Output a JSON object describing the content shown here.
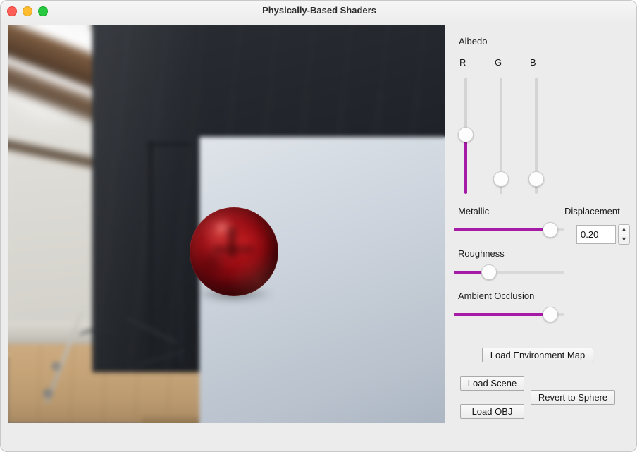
{
  "window": {
    "title": "Physically-Based Shaders",
    "traffic_lights": [
      {
        "name": "close",
        "color": "#ff5f57"
      },
      {
        "name": "minimize",
        "color": "#febc2e"
      },
      {
        "name": "maximize",
        "color": "#28c840"
      }
    ],
    "background": "#ececec"
  },
  "viewport": {
    "name": "3d-render-viewport",
    "description": "Blurred studio environment with metallic red PBR sphere"
  },
  "panel": {
    "albedo": {
      "label": "Albedo",
      "accent": "#a61ba6",
      "channels": [
        {
          "label": "R",
          "value": 0.51,
          "fill_below": true
        },
        {
          "label": "G",
          "value": 0.07,
          "fill_below": false
        },
        {
          "label": "B",
          "value": 0.07,
          "fill_below": false
        }
      ]
    },
    "metallic": {
      "label": "Metallic",
      "value": 0.93,
      "accent": "#a61ba6"
    },
    "roughness": {
      "label": "Roughness",
      "value": 0.29,
      "accent": "#a61ba6"
    },
    "ambient_occlusion": {
      "label": "Ambient Occlusion",
      "value": 0.93,
      "accent": "#a61ba6"
    },
    "displacement": {
      "label": "Displacement",
      "value": "0.20",
      "stepper_up": "▲",
      "stepper_down": "▼"
    },
    "buttons": [
      {
        "name": "load-environment-map-button",
        "label": "Load Environment Map"
      },
      {
        "name": "load-scene-button",
        "label": "Load Scene"
      },
      {
        "name": "revert-to-sphere-button",
        "label": "Revert to Sphere"
      },
      {
        "name": "load-obj-button",
        "label": "Load OBJ"
      }
    ]
  }
}
